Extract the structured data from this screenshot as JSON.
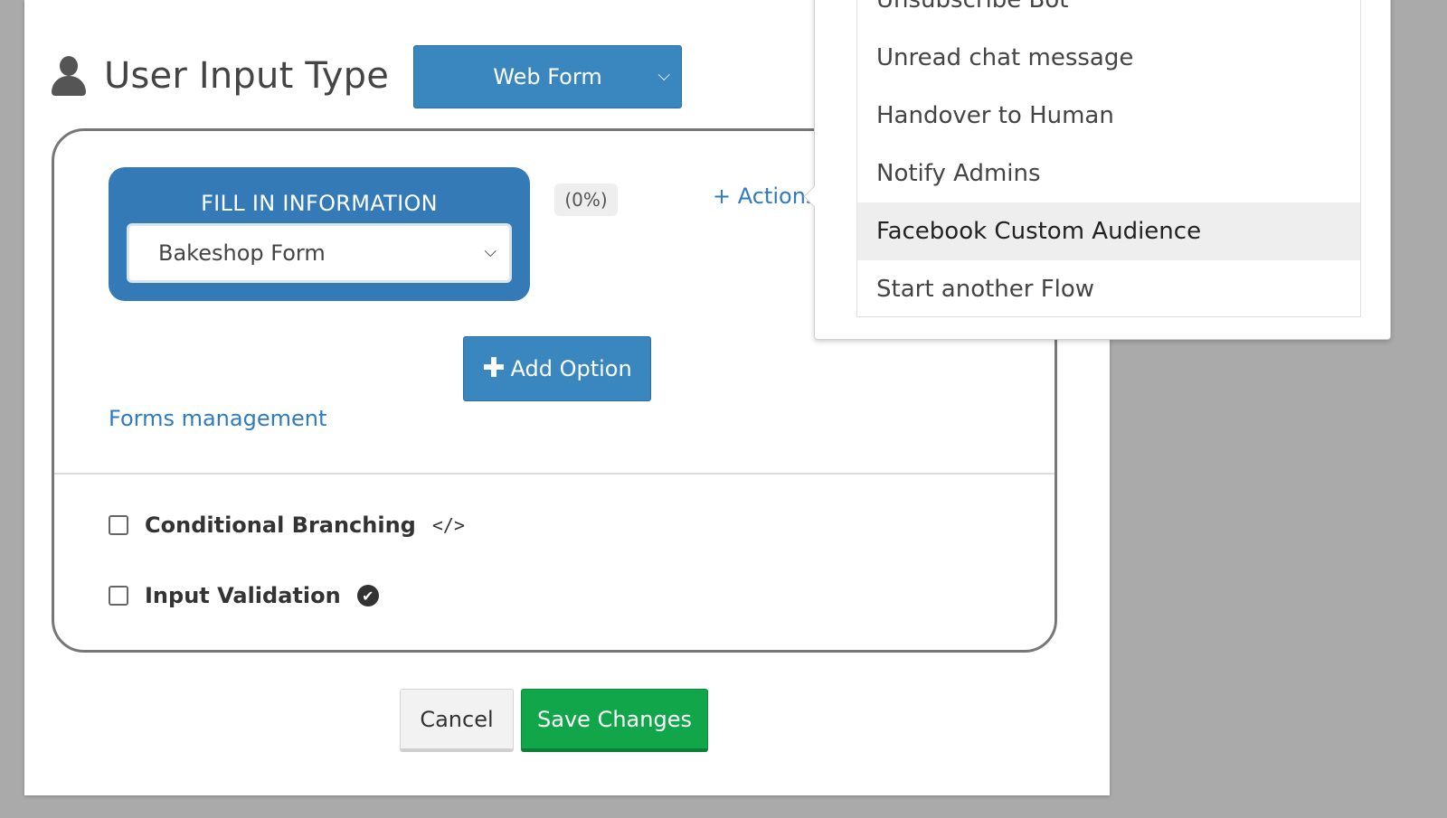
{
  "header": {
    "title": "User Input Type",
    "user_icon": "user-icon"
  },
  "input_type": {
    "selected": "Web Form",
    "icon": "chevron-down-icon"
  },
  "fill_in": {
    "title": "FILL IN INFORMATION",
    "form_selected": "Bakeshop Form",
    "progress": "(0%)"
  },
  "actions": {
    "label": "+ Actions"
  },
  "add_option": {
    "plus": "✚",
    "label": "Add Option"
  },
  "forms_management": {
    "label": "Forms management"
  },
  "options": {
    "conditional_branching": {
      "label": "Conditional Branching",
      "icon": "</>"
    },
    "input_validation": {
      "label": "Input Validation",
      "icon": "✔"
    }
  },
  "footer": {
    "cancel": "Cancel",
    "save": "Save Changes"
  },
  "actions_menu": {
    "items": [
      {
        "label": "Unsubscribe Bot"
      },
      {
        "label": "Unread chat message"
      },
      {
        "label": "Handover to Human"
      },
      {
        "label": "Notify Admins"
      },
      {
        "label": "Facebook Custom Audience"
      },
      {
        "label": "Start another Flow"
      }
    ],
    "highlighted": "Facebook Custom Audience"
  },
  "colors": {
    "primary": "#337ab7",
    "success": "#12a64a",
    "link": "#2f7bbf",
    "backdrop": "#aaaaaa"
  }
}
